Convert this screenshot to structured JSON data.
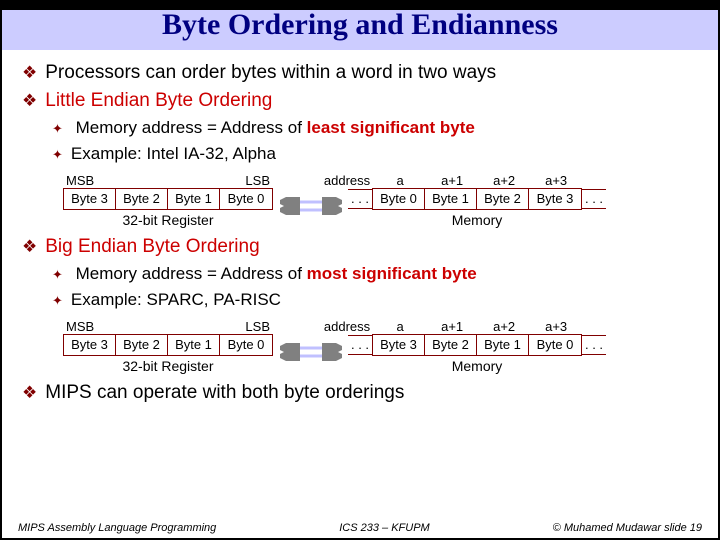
{
  "title": "Byte Ordering and Endianness",
  "bullets": {
    "b1": "Processors can order bytes within a word in two ways",
    "b2": "Little Endian Byte Ordering",
    "b2_1a": "Memory address = Address of",
    "b2_1b": "least significant byte",
    "b2_2": "Example: Intel IA-32, Alpha",
    "b3": "Big Endian Byte Ordering",
    "b3_1a": "Memory address = Address of",
    "b3_1b": "most significant byte",
    "b3_2": "Example: SPARC, PA-RISC",
    "b4": "MIPS can operate with both byte orderings"
  },
  "labels": {
    "msb": "MSB",
    "lsb": "LSB",
    "byte3": "Byte 3",
    "byte2": "Byte 2",
    "byte1": "Byte 1",
    "byte0": "Byte 0",
    "reg_caption": "32-bit Register",
    "address": "address",
    "a": "a",
    "a1": "a+1",
    "a2": "a+2",
    "a3": "a+3",
    "dots": ". . .",
    "memory": "Memory"
  },
  "footer": {
    "left": "MIPS Assembly Language Programming",
    "center": "ICS 233 – KFUPM",
    "right": "© Muhamed Mudawar   slide 19"
  }
}
